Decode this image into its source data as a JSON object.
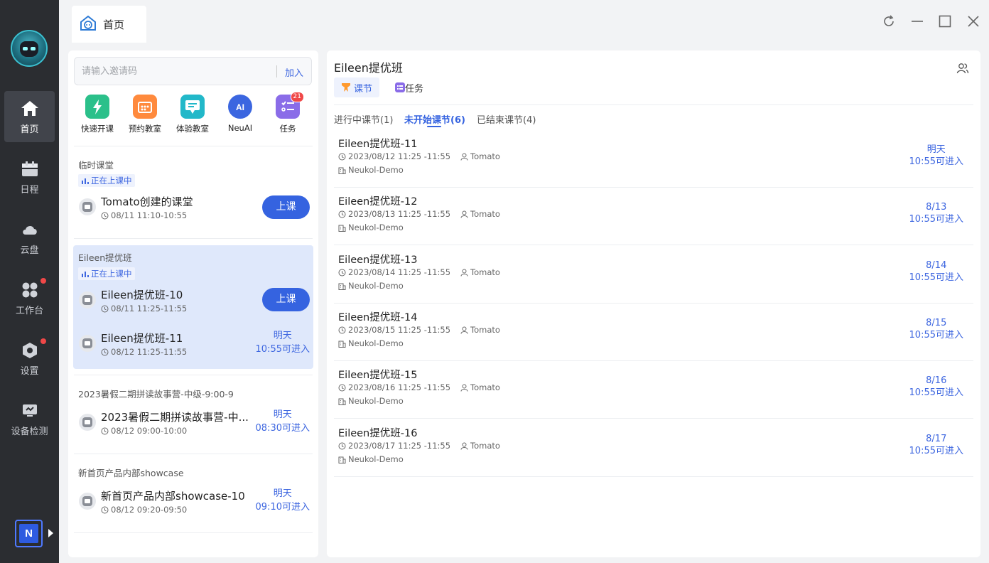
{
  "app": {
    "tab_title": "首页"
  },
  "nav": [
    {
      "label": "首页",
      "icon": "home-icon"
    },
    {
      "label": "日程",
      "icon": "calendar-icon"
    },
    {
      "label": "云盘",
      "icon": "cloud-icon"
    },
    {
      "label": "工作台",
      "icon": "workbench-icon"
    },
    {
      "label": "设置",
      "icon": "settings-icon"
    },
    {
      "label": "设备检测",
      "icon": "device-check-icon"
    }
  ],
  "org_badge": "N",
  "invite": {
    "placeholder": "请输入邀请码",
    "join_label": "加入"
  },
  "quick_actions": [
    {
      "label": "快速开课",
      "icon": "quick-class-icon",
      "color": "#2bc08a"
    },
    {
      "label": "预约教室",
      "icon": "reserve-room-icon",
      "color": "#ff8a3d"
    },
    {
      "label": "体验教室",
      "icon": "trial-room-icon",
      "color": "#22b8c9"
    },
    {
      "label": "NeuAI",
      "icon": "neuai-icon",
      "color": "#3b66e0"
    },
    {
      "label": "任务",
      "icon": "task-icon",
      "color": "#8a6ce8",
      "badge": "21"
    }
  ],
  "groups": [
    {
      "title": "临时课堂",
      "live_tag": "正在上课中",
      "classes": [
        {
          "title": "Tomato创建的课堂",
          "time": "08/11 11:10-10:55",
          "action": "上课"
        }
      ]
    },
    {
      "title": "Eileen提优班",
      "live_tag": "正在上课中",
      "classes": [
        {
          "title": "Eileen提优班-10",
          "time": "08/11 11:25-11:55",
          "action": "上课"
        },
        {
          "title": "Eileen提优班-11",
          "time": "08/12 11:25-11:55",
          "enter_line1": "明天",
          "enter_line2": "10:55可进入"
        }
      ]
    },
    {
      "title": "2023暑假二期拼读故事营-中级-9:00-9",
      "classes": [
        {
          "title": "2023暑假二期拼读故事营-中...",
          "time": "08/12 09:00-10:00",
          "enter_line1": "明天",
          "enter_line2": "08:30可进入"
        }
      ]
    },
    {
      "title": "新首页产品内部showcase",
      "classes": [
        {
          "title": "新首页产品内部showcase-10",
          "time": "08/12 09:20-09:50",
          "enter_line1": "明天",
          "enter_line2": "09:10可进入"
        }
      ]
    }
  ],
  "detail": {
    "title": "Eileen提优班",
    "segments": [
      {
        "label": "课节",
        "icon": "lesson-icon",
        "color": "#ff9a2e"
      },
      {
        "label": "任务",
        "icon": "task-list-icon",
        "color": "#8a6ce8"
      }
    ],
    "sub_tabs": [
      "进行中课节(1)",
      "未开始课节(6)",
      "已结束课节(4)"
    ],
    "active_sub_tab": "未开始课节(6)",
    "lessons": [
      {
        "title": "Eileen提优班-11",
        "time": "2023/08/12 11:25 -11:55",
        "teacher": "Tomato",
        "room": "Neukol-Demo",
        "enter_line1": "明天",
        "enter_line2": "10:55可进入"
      },
      {
        "title": "Eileen提优班-12",
        "time": "2023/08/13 11:25 -11:55",
        "teacher": "Tomato",
        "room": "Neukol-Demo",
        "enter_line1": "8/13",
        "enter_line2": "10:55可进入"
      },
      {
        "title": "Eileen提优班-13",
        "time": "2023/08/14 11:25 -11:55",
        "teacher": "Tomato",
        "room": "Neukol-Demo",
        "enter_line1": "8/14",
        "enter_line2": "10:55可进入"
      },
      {
        "title": "Eileen提优班-14",
        "time": "2023/08/15 11:25 -11:55",
        "teacher": "Tomato",
        "room": "Neukol-Demo",
        "enter_line1": "8/15",
        "enter_line2": "10:55可进入"
      },
      {
        "title": "Eileen提优班-15",
        "time": "2023/08/16 11:25 -11:55",
        "teacher": "Tomato",
        "room": "Neukol-Demo",
        "enter_line1": "8/16",
        "enter_line2": "10:55可进入"
      },
      {
        "title": "Eileen提优班-16",
        "time": "2023/08/17 11:25 -11:55",
        "teacher": "Tomato",
        "room": "Neukol-Demo",
        "enter_line1": "8/17",
        "enter_line2": "10:55可进入"
      }
    ]
  },
  "colors": {
    "accent": "#3563e0",
    "rail": "#2b2d31",
    "selected_row": "#dfe8fb"
  }
}
